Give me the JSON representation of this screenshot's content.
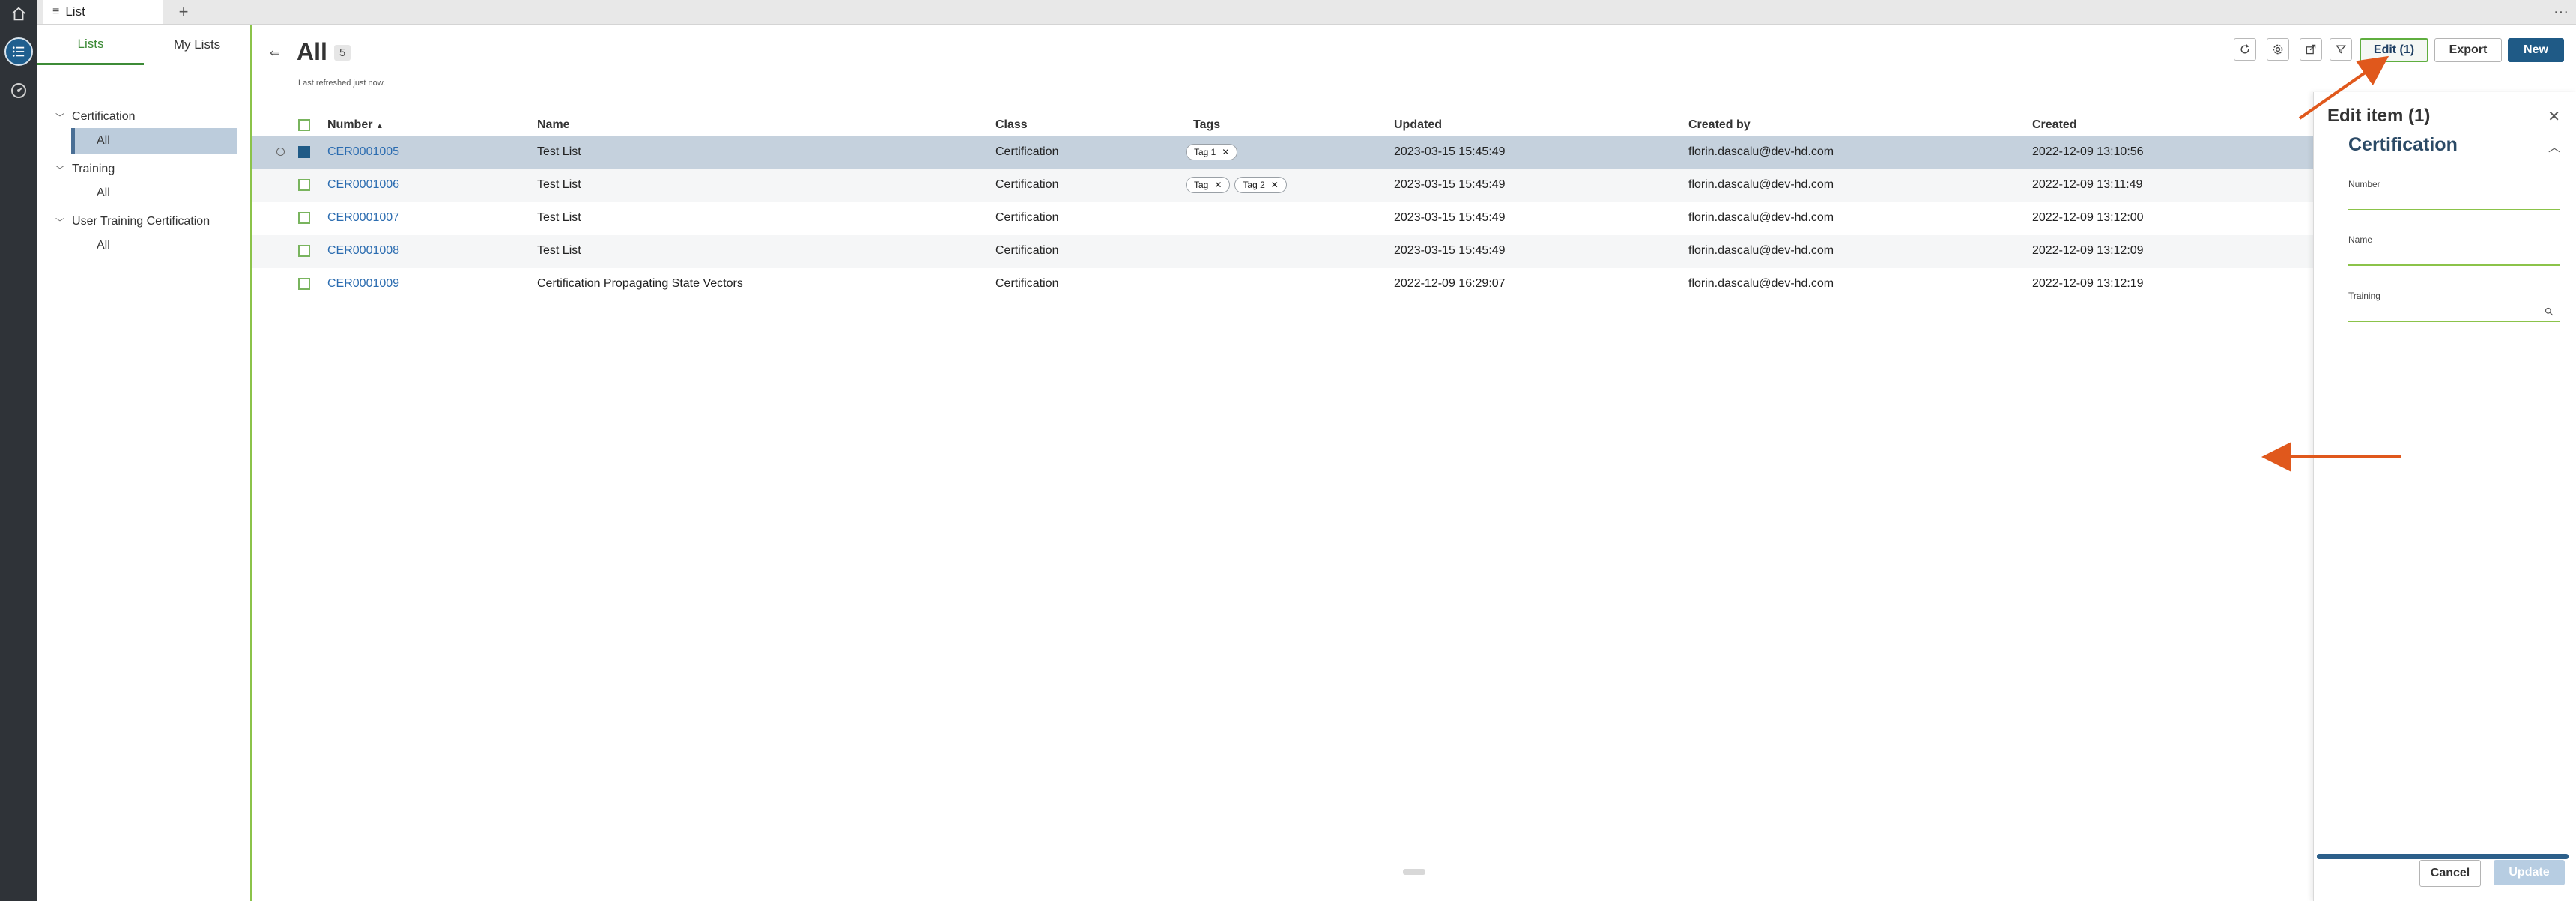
{
  "window": {
    "tab_label": "List",
    "tab_add": "+",
    "more": "···"
  },
  "lists_panel": {
    "tabs": [
      {
        "label": "Lists"
      },
      {
        "label": "My Lists"
      }
    ],
    "groups": [
      {
        "label": "Certification",
        "items": [
          {
            "label": "All",
            "selected": true
          }
        ]
      },
      {
        "label": "Training",
        "items": [
          {
            "label": "All",
            "selected": false
          }
        ]
      },
      {
        "label": "User Training Certification",
        "items": [
          {
            "label": "All",
            "selected": false
          }
        ]
      }
    ]
  },
  "header": {
    "collapse_glyph": "⇐",
    "title": "All",
    "count": "5",
    "last_refreshed": "Last refreshed just now."
  },
  "toolbar": {
    "icons": [
      "refresh-icon",
      "settings-icon",
      "share-icon",
      "filter-icon"
    ],
    "edit_label": "Edit (1)",
    "export_label": "Export",
    "new_label": "New"
  },
  "table": {
    "columns": [
      "Number",
      "Name",
      "Class",
      "Tags",
      "Updated",
      "Created by",
      "Created"
    ],
    "sort_indicator": "▲",
    "rows": [
      {
        "number": "CER0001005",
        "name": "Test List",
        "class": "Certification",
        "tags": [
          "Tag 1"
        ],
        "updated": "2023-03-15 15:45:49",
        "created_by": "florin.dascalu@dev-hd.com",
        "created": "2022-12-09 13:10:56",
        "selected": true
      },
      {
        "number": "CER0001006",
        "name": "Test List",
        "class": "Certification",
        "tags": [
          "Tag",
          "Tag 2"
        ],
        "updated": "2023-03-15 15:45:49",
        "created_by": "florin.dascalu@dev-hd.com",
        "created": "2022-12-09 13:11:49",
        "selected": false
      },
      {
        "number": "CER0001007",
        "name": "Test List",
        "class": "Certification",
        "tags": [],
        "updated": "2023-03-15 15:45:49",
        "created_by": "florin.dascalu@dev-hd.com",
        "created": "2022-12-09 13:12:00",
        "selected": false
      },
      {
        "number": "CER0001008",
        "name": "Test List",
        "class": "Certification",
        "tags": [],
        "updated": "2023-03-15 15:45:49",
        "created_by": "florin.dascalu@dev-hd.com",
        "created": "2022-12-09 13:12:09",
        "selected": false
      },
      {
        "number": "CER0001009",
        "name": "Certification Propagating State Vectors",
        "class": "Certification",
        "tags": [],
        "updated": "2022-12-09 16:29:07",
        "created_by": "florin.dascalu@dev-hd.com",
        "created": "2022-12-09 13:12:19",
        "selected": false
      }
    ],
    "tag_remove_glyph": "✕"
  },
  "edit_panel": {
    "title": "Edit item (1)",
    "close_glyph": "✕",
    "section": "Certification",
    "collapse_glyph": "︿",
    "fields": [
      {
        "label": "Number",
        "value": ""
      },
      {
        "label": "Name",
        "value": ""
      },
      {
        "label": "Training",
        "value": ""
      }
    ],
    "cancel_label": "Cancel",
    "update_label": "Update"
  },
  "colors": {
    "accent_green": "#3d8b37",
    "primary_blue": "#1f5a86",
    "annotation_orange": "#e0581c",
    "selected_row": "#c5d1dd"
  }
}
